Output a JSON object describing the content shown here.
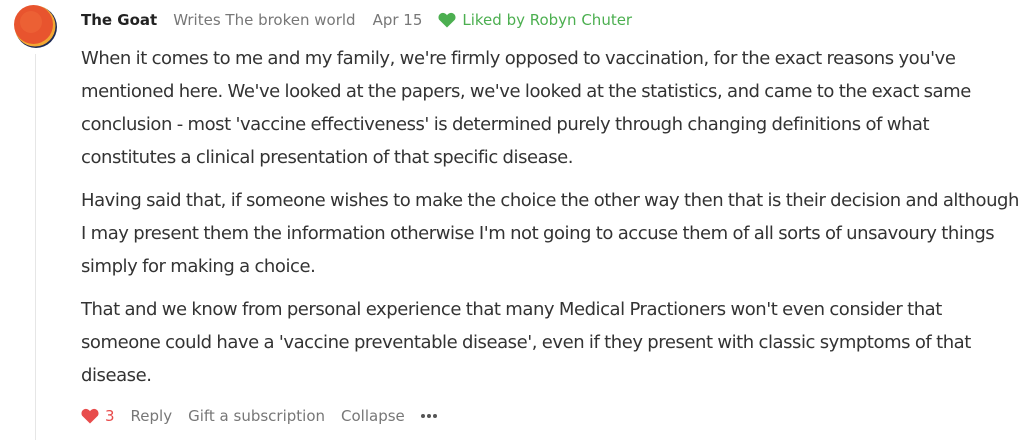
{
  "comment": {
    "author": "The Goat",
    "byline": "Writes The broken world",
    "date": "Apr 15",
    "liked_by": "Liked by Robyn Chuter",
    "paragraphs": [
      "When it comes to me and my family, we're firmly opposed to vaccination, for the exact reasons you've mentioned here. We've looked at the papers, we've looked at the statistics, and came to the exact same conclusion - most 'vaccine effectiveness' is determined purely through changing definitions of what constitutes a clinical presentation of that specific disease.",
      "Having said that, if someone wishes to make the choice the other way then that is their decision and although I may present them the information otherwise I'm not going to accuse them of all sorts of unsavoury things simply for making a choice.",
      "That and we know from personal experience that many Medical Practioners won't even consider that someone could have a 'vaccine preventable disease', even if they present with classic symptoms of that disease."
    ],
    "actions": {
      "like_count": "3",
      "reply": "Reply",
      "gift": "Gift a subscription",
      "collapse": "Collapse"
    },
    "icons": {
      "avatar": "avatar",
      "liked": "heart-icon",
      "like": "heart-icon",
      "more": "ellipsis-icon"
    },
    "colors": {
      "liked_green": "#4caf50",
      "like_red": "#e84c4c",
      "muted_text": "#777777",
      "body_text": "#333333"
    }
  }
}
